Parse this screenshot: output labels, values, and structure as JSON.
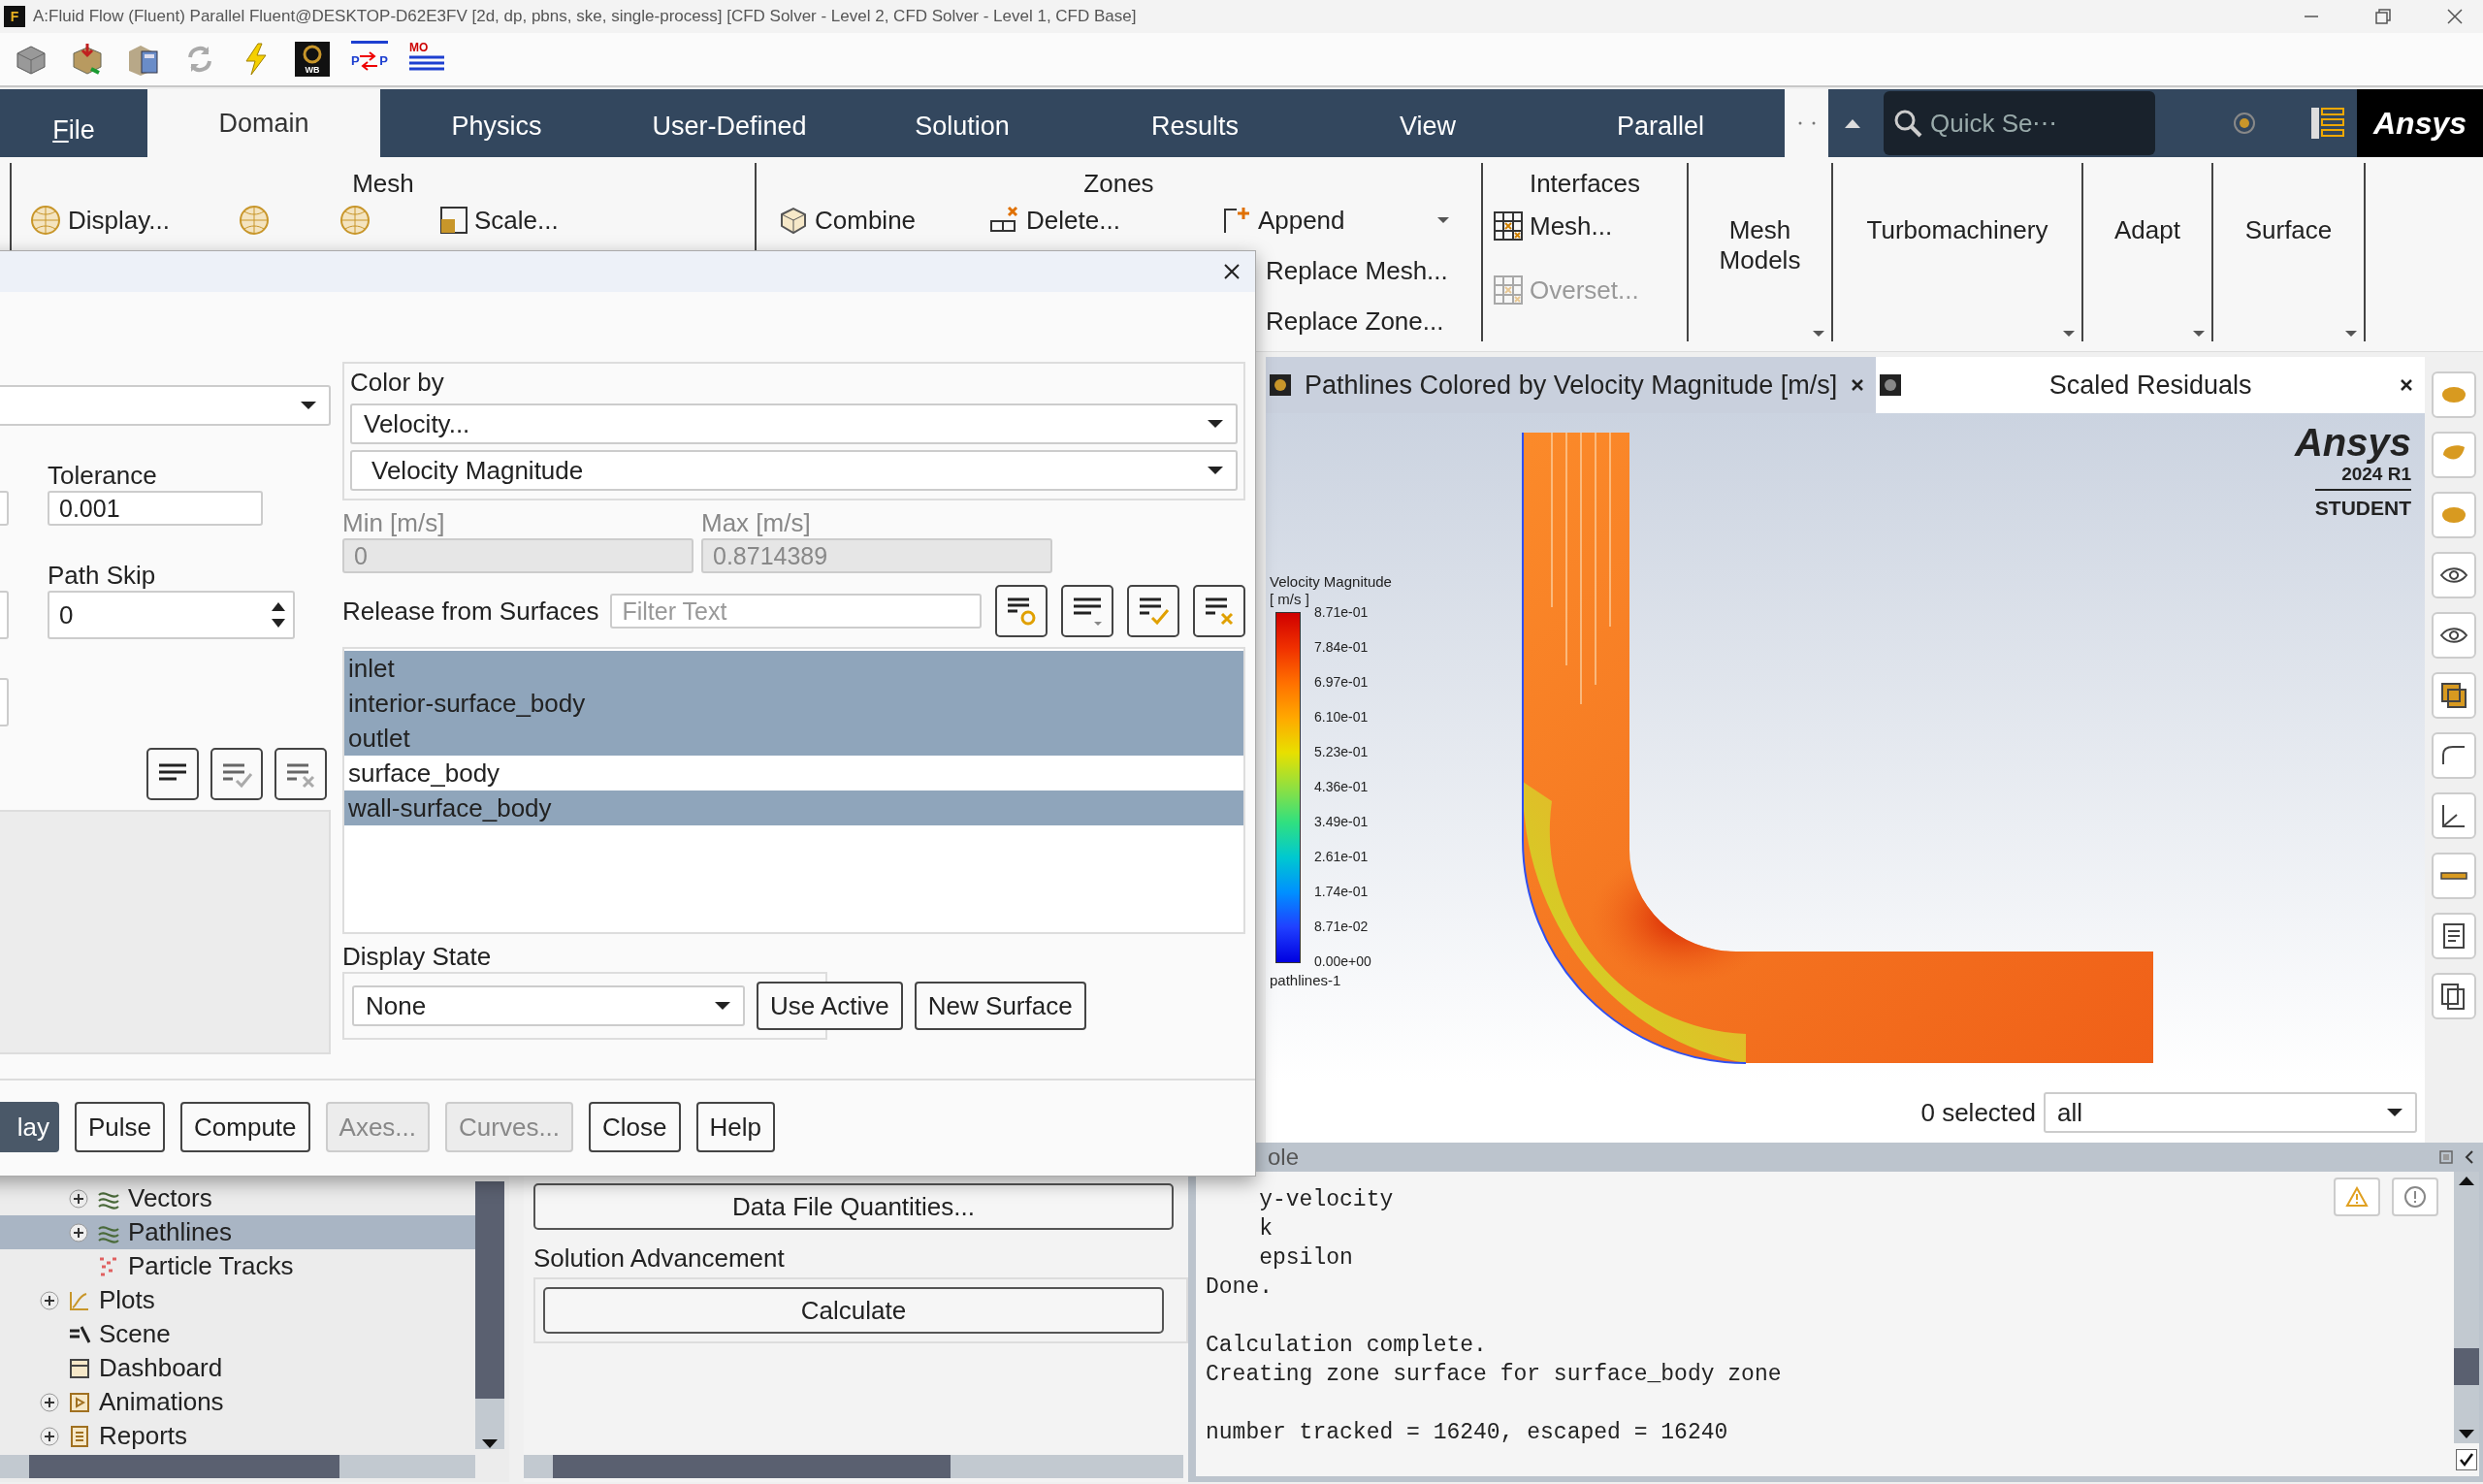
{
  "window": {
    "title": "A:Fluid Flow (Fluent) Parallel Fluent@DESKTOP-D62E3FV  [2d, dp, pbns, ske, single-process] [CFD Solver - Level 2, CFD Solver - Level 1, CFD Base]",
    "app_icon_text": "F"
  },
  "quick_toolbar": [
    {
      "kind": "cube"
    },
    {
      "kind": "import"
    },
    {
      "kind": "calculator"
    },
    {
      "kind": "refresh"
    },
    {
      "kind": "bolt"
    },
    {
      "kind": "wb",
      "texts": [
        "WB"
      ]
    },
    {
      "kind": "pp",
      "texts": [
        "P",
        "P"
      ]
    },
    {
      "kind": "mo",
      "texts": [
        "MO"
      ]
    }
  ],
  "ribbon_tabs": [
    {
      "label": "File",
      "selected": false,
      "mnemonic": true
    },
    {
      "label": "Domain",
      "selected": true,
      "mnemonic": false
    },
    {
      "label": "Physics",
      "selected": false,
      "mnemonic": false
    },
    {
      "label": "User-Defined",
      "selected": false,
      "mnemonic": false
    },
    {
      "label": "Solution",
      "selected": false,
      "mnemonic": false
    },
    {
      "label": "Results",
      "selected": false,
      "mnemonic": false
    },
    {
      "label": "View",
      "selected": false,
      "mnemonic": false
    },
    {
      "label": "Parallel",
      "selected": false,
      "mnemonic": false
    }
  ],
  "search": {
    "placeholder": "Quick Se⋯"
  },
  "brand": "Ansys",
  "ribbon_groups": [
    {
      "kind": "items",
      "title": "Mesh",
      "columns": [
        [
          {
            "label": "Display...",
            "kind": "globe",
            "disabled": false
          }
        ],
        [
          {
            "kind": "globe",
            "disabled": false
          }
        ],
        [
          {
            "kind": "globe",
            "disabled": false
          }
        ],
        [
          {
            "label": "Scale...",
            "kind": "scale",
            "disabled": false
          }
        ]
      ]
    },
    {
      "kind": "items",
      "title": "Zones",
      "columns": [
        [
          {
            "label": "Combine",
            "kind": "combine",
            "disabled": false
          }
        ],
        [
          {
            "label": "Delete...",
            "kind": "delete",
            "disabled": false
          }
        ],
        [
          {
            "label": "Append",
            "kind": "append",
            "disabled": false,
            "dropdown": true
          },
          {
            "label": "Replace Mesh...",
            "kind": "text",
            "disabled": false,
            "dropdown": false
          },
          {
            "label": "Replace Zone...",
            "kind": "text",
            "disabled": false,
            "dropdown": false
          }
        ]
      ]
    },
    {
      "kind": "items",
      "title": "Interfaces",
      "columns": [
        [
          {
            "label": "Mesh...",
            "kind": "grid",
            "disabled": false
          },
          {
            "label": "Overset...",
            "kind": "grid",
            "disabled": true
          }
        ]
      ]
    },
    {
      "kind": "menu",
      "label": "Mesh Models"
    },
    {
      "kind": "menu",
      "label": "Turbomachinery"
    },
    {
      "kind": "menu",
      "label": "Adapt"
    },
    {
      "kind": "menu",
      "label": "Surface"
    }
  ],
  "dialog": {
    "left": {
      "tolerance_label": "Tolerance",
      "tolerance": "0.001",
      "path_skip_label": "Path Skip",
      "path_skip": "0"
    },
    "color_by": {
      "label": "Color by",
      "field": "Velocity...",
      "subfield": "Velocity Magnitude"
    },
    "min": {
      "label": "Min [m/s]",
      "value": "0",
      "disabled": true
    },
    "max": {
      "label": "Max [m/s]",
      "value": "0.8714389",
      "disabled": true
    },
    "release": {
      "label": "Release from Surfaces",
      "filter_placeholder": "Filter Text",
      "surfaces": [
        {
          "name": "inlet",
          "selected": true
        },
        {
          "name": "interior-surface_body",
          "selected": true
        },
        {
          "name": "outlet",
          "selected": true
        },
        {
          "name": "surface_body",
          "selected": false
        },
        {
          "name": "wall-surface_body",
          "selected": true
        }
      ]
    },
    "display_state": {
      "label": "Display State",
      "value": "None",
      "buttons": [
        "Use Active",
        "New Surface"
      ]
    },
    "buttons": [
      {
        "label": "lay",
        "default": true,
        "disabled": false
      },
      {
        "label": "Pulse",
        "default": false,
        "disabled": false
      },
      {
        "label": "Compute",
        "default": false,
        "disabled": false
      },
      {
        "label": "Axes...",
        "default": false,
        "disabled": true
      },
      {
        "label": "Curves...",
        "default": false,
        "disabled": true
      },
      {
        "label": "Close",
        "default": false,
        "disabled": false
      },
      {
        "label": "Help",
        "default": false,
        "disabled": false
      }
    ]
  },
  "graphics": {
    "tabs": [
      {
        "label": "Pathlines Colored by Velocity Magnitude [m/s]",
        "selected": true
      },
      {
        "label": "Scaled Residuals",
        "selected": false
      }
    ],
    "legend": {
      "title": "Velocity Magnitude",
      "unit": "[ m/s ]",
      "ticks": [
        "8.71e-01",
        "7.84e-01",
        "6.97e-01",
        "6.10e-01",
        "5.23e-01",
        "4.36e-01",
        "3.49e-01",
        "2.61e-01",
        "1.74e-01",
        "8.71e-02",
        "0.00e+00"
      ],
      "caption": "pathlines-1"
    },
    "logo": {
      "brand": "Ansys",
      "version": "2024 R1",
      "edition": "STUDENT"
    },
    "selection": {
      "count": "0 selected",
      "filter": "all"
    }
  },
  "tree": {
    "items": [
      {
        "children": [
          {
            "label": "Vectors",
            "kind": "lines",
            "expandable": true,
            "selected": false
          },
          {
            "label": "Pathlines",
            "kind": "lines",
            "expandable": true,
            "selected": true
          },
          {
            "label": "Particle Tracks",
            "kind": "dots",
            "expandable": false,
            "selected": false
          }
        ]
      },
      {
        "label": "Plots",
        "kind": "chart",
        "expandable": true,
        "selected": false
      },
      {
        "label": "Scene",
        "kind": "scene",
        "expandable": false,
        "selected": false
      },
      {
        "label": "Dashboard",
        "kind": "panel",
        "expandable": false,
        "selected": false
      },
      {
        "label": "Animations",
        "kind": "film",
        "expandable": true,
        "selected": false
      },
      {
        "label": "Reports",
        "kind": "report",
        "expandable": true,
        "selected": false
      }
    ]
  },
  "task_page": {
    "button": "Data File Quantities...",
    "section": "Solution Advancement",
    "action": "Calculate"
  },
  "console": {
    "title": "ole",
    "blocks": [
      [
        "    y-velocity",
        "    k",
        "    epsilon",
        "Done."
      ],
      [
        "Calculation complete.",
        "Creating zone surface for surface_body zone"
      ],
      [
        "number tracked = 16240, escaped = 16240"
      ]
    ],
    "autoscroll_checked": true
  }
}
